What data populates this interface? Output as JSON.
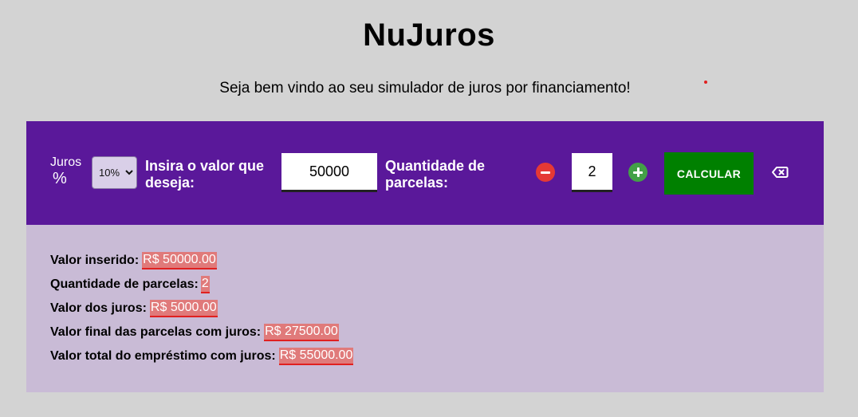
{
  "header": {
    "title": "NuJuros",
    "subtitle": "Seja bem vindo ao seu simulador de juros por financiamento!"
  },
  "form": {
    "juros_label": "Juros",
    "juros_symbol": "%",
    "rate_selected": "10%",
    "value_label": "Insira o valor que deseja:",
    "value_input": "50000",
    "parcelas_label": "Quantidade de parcelas:",
    "parcelas_input": "2",
    "calculate_label": "CALCULAR",
    "minus_icon": "minus-circle-icon",
    "plus_icon": "plus-circle-icon",
    "clear_icon": "backspace-icon"
  },
  "results": {
    "valor_inserido_label": "Valor inserido:",
    "valor_inserido": "R$ 50000.00",
    "quantidade_label": "Quantidade de parcelas:",
    "quantidade": "2",
    "valor_juros_label": "Valor dos juros:",
    "valor_juros": "R$ 5000.00",
    "valor_final_label": "Valor final das parcelas com juros:",
    "valor_final": "R$ 27500.00",
    "valor_total_label": "Valor total do empréstimo com juros:",
    "valor_total": "R$ 55000.00"
  },
  "colors": {
    "background": "#d3d3d3",
    "panel_purple": "#5a189a",
    "results_bg": "#c9bbd6",
    "calculate_green": "#008000",
    "minus_red": "#e53935",
    "plus_green": "#43a047",
    "highlight": "#e07a7a"
  }
}
